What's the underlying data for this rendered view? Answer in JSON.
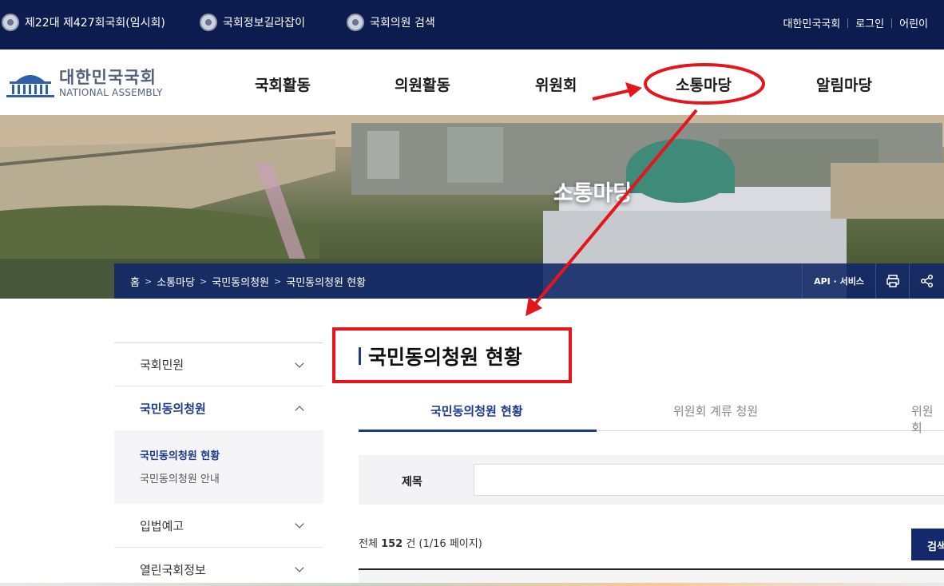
{
  "topbar": {
    "session": "제22대 제427회국회(임시회)",
    "guide": "국회정보길라잡이",
    "member_search": "국회의원 검색",
    "links": [
      "대한민국국회",
      "로그인",
      "어린이"
    ]
  },
  "logo": {
    "ko": "대한민국국회",
    "en": "NATIONAL ASSEMBLY"
  },
  "gnb": [
    "국회활동",
    "의원활동",
    "위원회",
    "소통마당",
    "알림마당"
  ],
  "visual": {
    "title": "소통마당",
    "breadcrumb": [
      "홈",
      "소통마당",
      "국민동의청원",
      "국민동의청원 현황"
    ],
    "api_label": "API · 서비스"
  },
  "lnb": {
    "items": [
      "국회민원",
      "국민동의청원",
      "입법예고",
      "열린국회정보"
    ],
    "sub_items": [
      "국민동의청원 현황",
      "국민동의청원 안내"
    ]
  },
  "content": {
    "title": "국민동의청원 현황",
    "tabs": [
      "국민동의청원 현황",
      "위원회 계류 청원",
      "위원회"
    ],
    "search_label": "제목",
    "count_prefix": "전체",
    "count_value": "152",
    "count_suffix": "건 (1/16 페이지)",
    "search_button": "검색"
  },
  "colors": {
    "navy": "#0d1c4e",
    "accent": "#1a3a8c",
    "annotation": "#e4151b"
  },
  "icons": [
    "assembly-seal-icon",
    "print-icon",
    "share-icon",
    "chevron-down-icon",
    "chevron-up-icon"
  ]
}
